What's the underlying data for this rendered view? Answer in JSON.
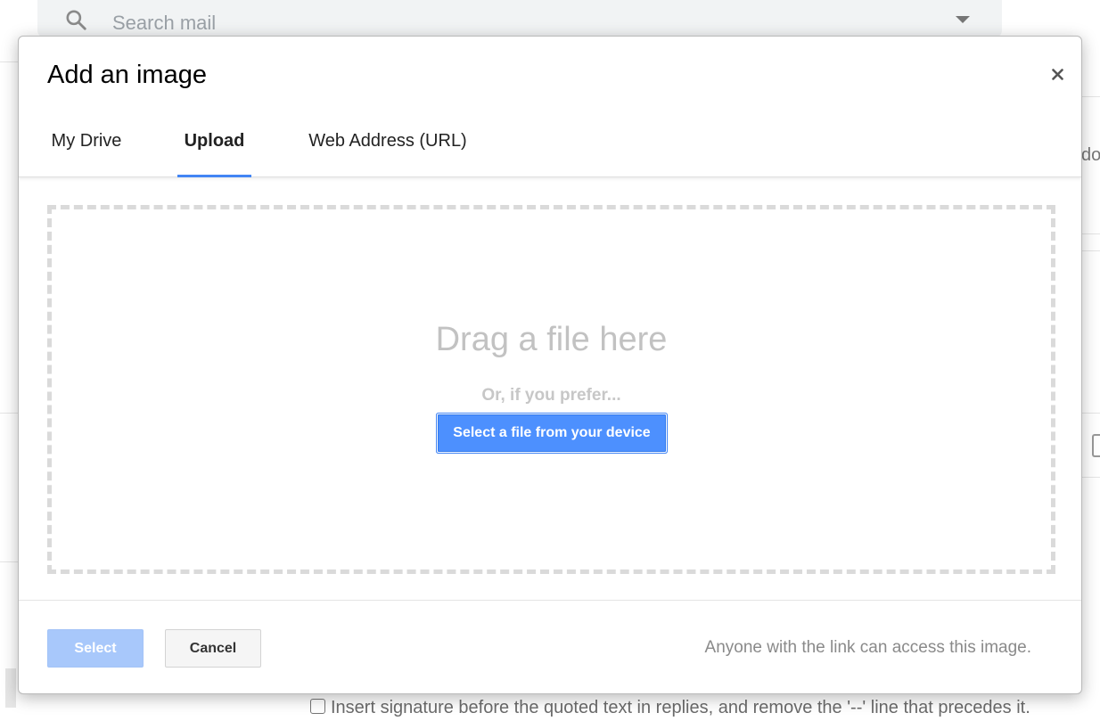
{
  "background": {
    "search": {
      "placeholder": "Search mail"
    },
    "fragment_text": "do",
    "signature_option": "Insert signature before the quoted text in replies, and remove the '--' line that precedes it."
  },
  "dialog": {
    "title": "Add an image",
    "tabs": [
      {
        "label": "My Drive",
        "active": false
      },
      {
        "label": "Upload",
        "active": true
      },
      {
        "label": "Web Address (URL)",
        "active": false
      }
    ],
    "dropzone": {
      "heading": "Drag a file here",
      "alt_text": "Or, if you prefer...",
      "button_label": "Select a file from your device"
    },
    "footer": {
      "select_label": "Select",
      "cancel_label": "Cancel",
      "note": "Anyone with the link can access this image."
    },
    "icons": {
      "close": "close-icon",
      "search": "search-icon",
      "dropdown": "dropdown-arrow-icon"
    }
  },
  "colors": {
    "accent": "#4285f4",
    "primary_button": "#4d90fe",
    "disabled_button": "#a8c8fb",
    "dropzone_border": "#dadada"
  }
}
